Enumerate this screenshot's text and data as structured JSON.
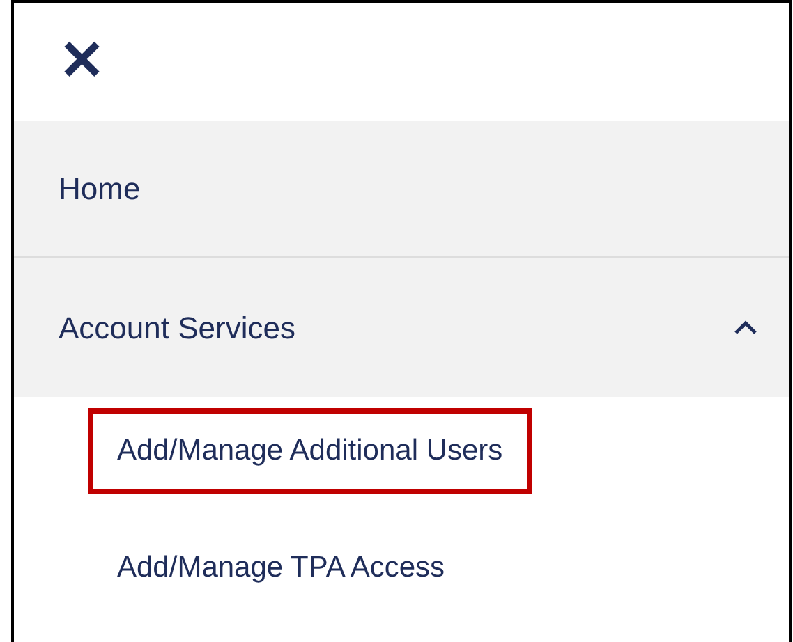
{
  "close": {
    "glyph": "✕"
  },
  "items": [
    {
      "label": "Home",
      "kind": "link"
    },
    {
      "label": "Account Services",
      "kind": "group",
      "expanded": true,
      "children": [
        {
          "label": "Add/Manage Additional Users",
          "highlighted": true
        },
        {
          "label": "Add/Manage TPA Access",
          "highlighted": false
        }
      ]
    }
  ]
}
